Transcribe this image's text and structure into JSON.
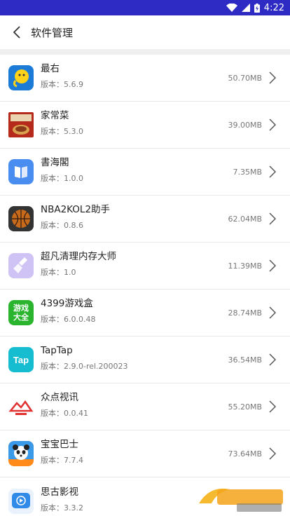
{
  "status_bar": {
    "time": "4:22",
    "battery_level": "4"
  },
  "header": {
    "title": "软件管理",
    "back_icon": "chevron-left-icon"
  },
  "apps": [
    {
      "name": "最右",
      "version": "版本：5.6.9",
      "size": "50.70MB",
      "icon": "zuiyou-icon",
      "icon_color": "#1b7bd6"
    },
    {
      "name": "家常菜",
      "version": "版本：5.3.0",
      "size": "39.00MB",
      "icon": "jiachangcai-icon",
      "icon_color": "#b52a1b"
    },
    {
      "name": "書海閣",
      "version": "版本：1.0.0",
      "size": "7.35MB",
      "icon": "book-icon",
      "icon_color": "#4a8df0"
    },
    {
      "name": "NBA2KOL2助手",
      "version": "版本：0.8.6",
      "size": "62.04MB",
      "icon": "basketball-icon",
      "icon_color": "#333333"
    },
    {
      "name": "超凡清理内存大师",
      "version": "版本：1.0",
      "size": "11.39MB",
      "icon": "broom-icon",
      "icon_color": "#cfc2f5"
    },
    {
      "name": "4399游戏盒",
      "version": "版本：6.0.0.48",
      "size": "28.74MB",
      "icon": "game-box-icon",
      "icon_color": "#2bb52f",
      "icon_text": "游戏大全"
    },
    {
      "name": "TapTap",
      "version": "版本：2.9.0-rel.200023",
      "size": "36.54MB",
      "icon": "taptap-icon",
      "icon_color": "#16bccf",
      "icon_text": "Tap"
    },
    {
      "name": "众点视讯",
      "version": "版本：0.0.41",
      "size": "55.20MB",
      "icon": "mountain-logo-icon",
      "icon_color": "#e03030"
    },
    {
      "name": "宝宝巴士",
      "version": "版本：7.7.4",
      "size": "73.64MB",
      "icon": "panda-icon",
      "icon_color": "#ff8a1a"
    },
    {
      "name": "思古影视",
      "version": "版本：3.3.2",
      "size": "",
      "icon": "video-play-icon",
      "icon_color": "#2f8ae8"
    }
  ]
}
